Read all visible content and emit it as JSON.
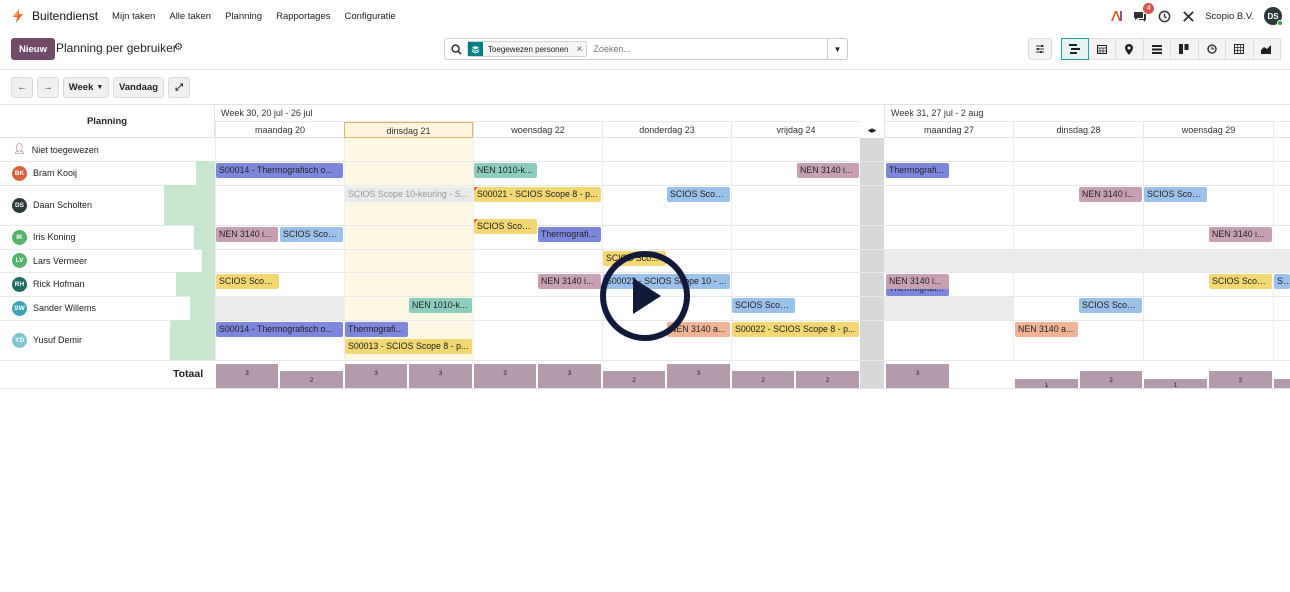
{
  "navbar": {
    "app_name": "Buitendienst",
    "menu": [
      "Mijn taken",
      "Alle taken",
      "Planning",
      "Rapportages",
      "Configuratie"
    ],
    "message_count": "4",
    "company": "Scopio B.V.",
    "user_initials": "DS"
  },
  "control_panel": {
    "new_button": "Nieuw",
    "title": "Planning per gebruiker",
    "facet_label": "Toegewezen personen",
    "search_placeholder": "Zoeken...",
    "views": [
      "gantt",
      "calendar",
      "map",
      "list",
      "kanban",
      "activity",
      "pivot",
      "graph"
    ],
    "active_view": "gantt"
  },
  "toolbar": {
    "prev": "←",
    "next": "→",
    "scale": "Week",
    "today": "Vandaag",
    "expand": "⤢"
  },
  "gantt": {
    "header_label": "Planning",
    "weeks": [
      {
        "label": "Week 30, 20 jul - 26 jul"
      },
      {
        "label": "Week 31, 27 jul - 2 aug"
      }
    ],
    "days": [
      {
        "label": "maandag 20"
      },
      {
        "label": "dinsdag 21",
        "today": true
      },
      {
        "label": "woensdag 22"
      },
      {
        "label": "donderdag 23"
      },
      {
        "label": "vrijdag 24"
      },
      {
        "label": "maandag 27"
      },
      {
        "label": "dinsdag 28"
      },
      {
        "label": "woensdag 29"
      }
    ],
    "gap_label": "◂▸",
    "rows": [
      {
        "name": "Niet toegewezen",
        "initials": "",
        "color": ""
      },
      {
        "name": "Bram Kooij",
        "initials": "BK",
        "color": "#d9603b"
      },
      {
        "name": "Daan Scholten",
        "initials": "DS",
        "color": "#2d3a3a"
      },
      {
        "name": "Iris Koning",
        "initials": "IK",
        "color": "#55b36a"
      },
      {
        "name": "Lars Vermeer",
        "initials": "LV",
        "color": "#55b36a"
      },
      {
        "name": "Rick Hofman",
        "initials": "RH",
        "color": "#1f6b5f"
      },
      {
        "name": "Sander Willems",
        "initials": "SW",
        "color": "#3ca6b8"
      },
      {
        "name": "Yusuf Demir",
        "initials": "YD",
        "color": "#7fc4d0"
      }
    ],
    "pills": {
      "bk1": "S00014 - Thermografisch o...",
      "bk2": "NEN 1010-k...",
      "bk3": "NEN 3140 i...",
      "bk4": "Thermografi...",
      "ds1": "SCIOS Scope 10-keuring - S...",
      "ds2": "S00021 - SCIOS Scope 8 - p...",
      "ds3": "SCIOS Scop...",
      "ds4": "SCIOS Scop...",
      "ds5": "NEN 3140 i...",
      "ds6": "SCIOS Scop...",
      "ik1": "NEN 3140 i...",
      "ik2": "SCIOS Scop...",
      "ik3": "Thermografi...",
      "ik4": "NEN 3140 i...",
      "lv1": "SCIOS Sco...",
      "lv2": "Thermografi...",
      "rh1": "SCIOS Scop...",
      "rh2": "NEN 3140 i...",
      "rh3": "S00023 - SCIOS Scope 10 - ...",
      "rh4": "NEN 3140 i...",
      "rh5": "SCIOS Scop...",
      "rh6": "SCI",
      "sw1": "NEN 1010-k...",
      "sw2": "SCIOS Scop...",
      "sw3": "SCIOS Scop...",
      "yd1": "S00014 - Thermografisch o...",
      "yd2": "Thermografi...",
      "yd3": "S00013 - SCIOS Scope 8 - p...",
      "yd4": "NEN 3140 a...",
      "yd5": "S00022 - SCIOS Scope 8 - p...",
      "yd6": "NEN 3140 a..."
    },
    "totals_label": "Totaal",
    "totals": [
      "3",
      "2",
      "3",
      "3",
      "3",
      "3",
      "2",
      "3",
      "2",
      "2",
      "3",
      "1",
      "2",
      "1",
      "2"
    ]
  },
  "overlay": {
    "play_icon": "play-icon"
  },
  "colors": {
    "brand": "#714b67",
    "accent": "#017e84",
    "today_bg": "#fdf8e4"
  }
}
